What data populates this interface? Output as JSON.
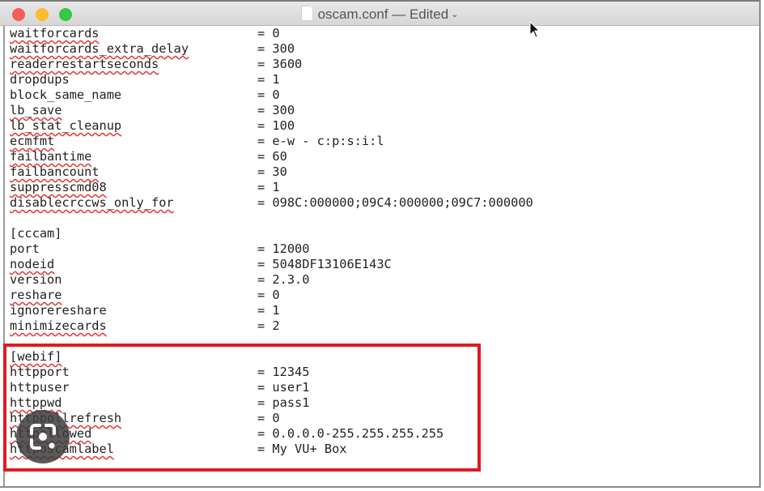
{
  "window": {
    "title": "oscam.conf",
    "status": "— Edited",
    "title_chevron": "⌄",
    "traffic_lights": [
      "close",
      "minimize",
      "zoom"
    ],
    "colors": {
      "close": "#f25f58",
      "minimize": "#fbbc2e",
      "zoom": "#34c748",
      "highlight_box": "#e01a22"
    }
  },
  "editor": {
    "lines": [
      {
        "key": "waitforcards",
        "value": "= 0",
        "misspelled": true
      },
      {
        "key": "waitforcards_extra_delay",
        "value": "= 300",
        "misspelled": true
      },
      {
        "key": "readerrestartseconds",
        "value": "= 3600",
        "misspelled": true
      },
      {
        "key": "dropdups",
        "value": "= 1",
        "misspelled": false
      },
      {
        "key": "block_same_name",
        "value": "= 0",
        "misspelled": false
      },
      {
        "key": "lb_save",
        "value": "= 300",
        "misspelled": true
      },
      {
        "key": "lb_stat_cleanup",
        "value": "= 100",
        "misspelled": true
      },
      {
        "key": "ecmfmt",
        "value": "= e-w - c:p:s:i:l",
        "misspelled": true
      },
      {
        "key": "failbantime",
        "value": "= 60",
        "misspelled": true
      },
      {
        "key": "failbancount",
        "value": "= 30",
        "misspelled": true
      },
      {
        "key": "suppresscmd08",
        "value": "= 1",
        "misspelled": true
      },
      {
        "key": "disablecrccws_only_for",
        "value": "= 098C:000000;09C4:000000;09C7:000000",
        "misspelled": true
      },
      {
        "key": "",
        "value": "",
        "misspelled": false
      },
      {
        "key": "[cccam]",
        "value": "",
        "misspelled": false
      },
      {
        "key": "port",
        "value": "= 12000",
        "misspelled": false
      },
      {
        "key": "nodeid",
        "value": "= 5048DF13106E143C",
        "misspelled": true
      },
      {
        "key": "version",
        "value": "= 2.3.0",
        "misspelled": false
      },
      {
        "key": "reshare",
        "value": "= 0",
        "misspelled": true
      },
      {
        "key": "ignorereshare",
        "value": "= 1",
        "misspelled": false
      },
      {
        "key": "minimizecards",
        "value": "= 2",
        "misspelled": true
      },
      {
        "key": "",
        "value": "",
        "misspelled": false
      },
      {
        "key": "[webif]",
        "value": "",
        "misspelled": true
      },
      {
        "key": "httpport",
        "value": "= 12345",
        "misspelled": false
      },
      {
        "key": "httpuser",
        "value": "= user1",
        "misspelled": false
      },
      {
        "key": "httppwd",
        "value": "= pass1",
        "misspelled": true
      },
      {
        "key": "httppollrefresh",
        "value": "= 0",
        "misspelled": true
      },
      {
        "key": "httpallowed",
        "value": "= 0.0.0.0-255.255.255.255",
        "misspelled": true
      },
      {
        "key": "httposcamlabel",
        "value": "= My VU+ Box",
        "misspelled": true
      }
    ]
  },
  "overlay": {
    "highlighted_section": "[webif]",
    "lens_button": "google-lens-icon"
  }
}
